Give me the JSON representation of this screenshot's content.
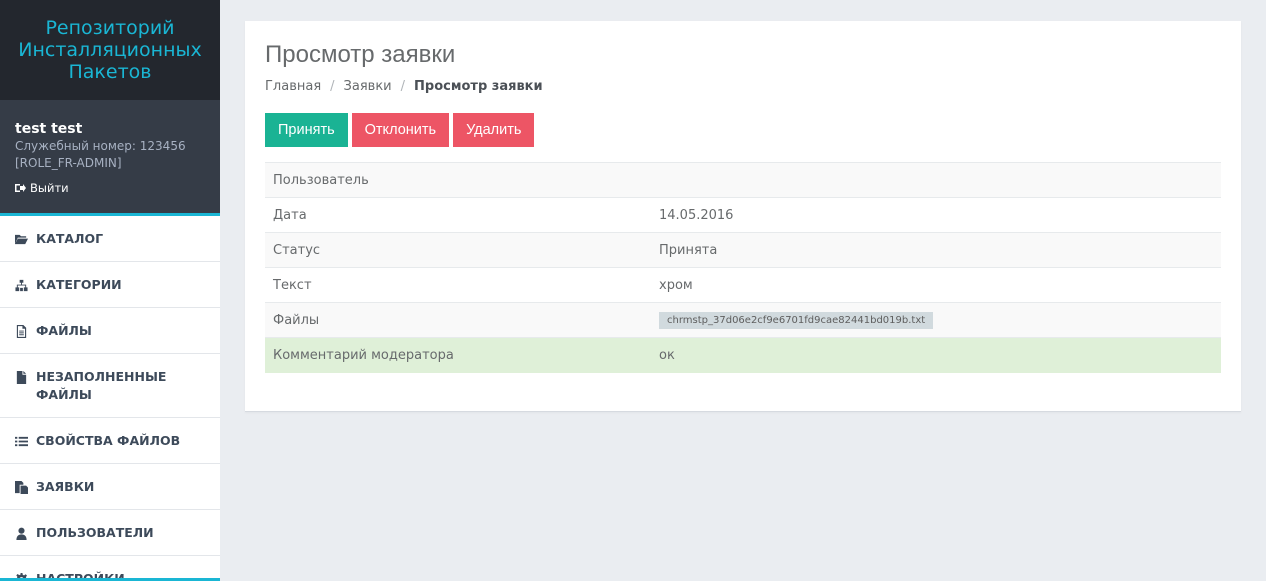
{
  "sidebar": {
    "brand": "Репозиторий Инсталляционных Пакетов",
    "user": {
      "name": "test test",
      "service_number": "Служебный номер: 123456",
      "role": "[ROLE_FR-ADMIN]",
      "logout": "Выйти"
    },
    "menu": [
      {
        "label": "КАТАЛОГ",
        "icon": "folder-open-icon"
      },
      {
        "label": "КАТЕГОРИИ",
        "icon": "sitemap-icon"
      },
      {
        "label": "ФАЙЛЫ",
        "icon": "file-text-icon"
      },
      {
        "label": "НЕЗАПОЛНЕННЫЕ ФАЙЛЫ",
        "icon": "file-icon"
      },
      {
        "label": "СВОЙСТВА ФАЙЛОВ",
        "icon": "list-icon"
      },
      {
        "label": "ЗАЯВКИ",
        "icon": "copy-icon"
      },
      {
        "label": "ПОЛЬЗОВАТЕЛИ",
        "icon": "user-icon"
      },
      {
        "label": "НАСТРОЙКИ",
        "icon": "gear-icon"
      }
    ]
  },
  "main": {
    "title": "Просмотр заявки",
    "breadcrumb": [
      "Главная",
      "Заявки",
      "Просмотр заявки"
    ],
    "buttons": {
      "accept": "Принять",
      "reject": "Отклонить",
      "delete": "Удалить"
    },
    "rows": [
      {
        "label": "Пользователь",
        "value": ""
      },
      {
        "label": "Дата",
        "value": "14.05.2016"
      },
      {
        "label": "Статус",
        "value": "Принята"
      },
      {
        "label": "Текст",
        "value": "хром"
      },
      {
        "label": "Файлы",
        "value": "chrmstp_37d06e2cf9e6701fd9cae82441bd019b.txt"
      },
      {
        "label": "Комментарий модератора",
        "value": "ок"
      }
    ]
  },
  "colors": {
    "accent": "#1ab6d4",
    "success": "#1ab394",
    "danger": "#ed5565",
    "sidebar_dark": "#23272e"
  }
}
